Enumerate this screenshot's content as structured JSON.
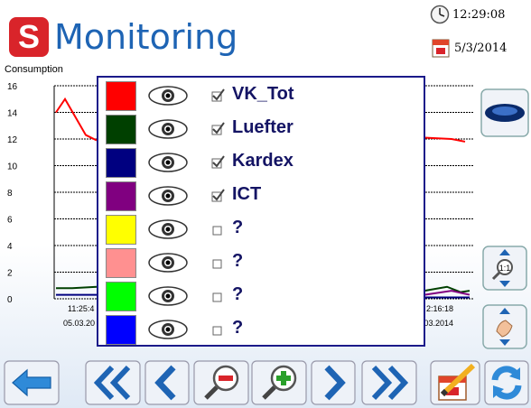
{
  "header": {
    "logo_letter": "S",
    "title": "Monitoring",
    "time": "12:29:08",
    "date": "5/3/2014"
  },
  "chart_data": {
    "type": "line",
    "ylabel": "Consumption",
    "ylim": [
      0,
      16
    ],
    "y_ticks": [
      "0",
      "2",
      "4",
      "6",
      "8",
      "10",
      "12",
      "14",
      "16"
    ],
    "x_tick_times": [
      "11:25:4",
      "2:16:18"
    ],
    "x_tick_dates": [
      "05.03.20",
      ".03.2014"
    ],
    "grid": true
  },
  "legend": {
    "series": [
      {
        "name": "VK_Tot",
        "color": "#ff0000",
        "checked": true
      },
      {
        "name": "Luefter",
        "color": "#004000",
        "checked": true
      },
      {
        "name": "Kardex",
        "color": "#000080",
        "checked": true
      },
      {
        "name": "ICT",
        "color": "#800080",
        "checked": true
      },
      {
        "name": "?",
        "color": "#ffff00",
        "checked": false
      },
      {
        "name": "?",
        "color": "#ff9090",
        "checked": false
      },
      {
        "name": "?",
        "color": "#00ff00",
        "checked": false
      },
      {
        "name": "?",
        "color": "#0000ff",
        "checked": false
      }
    ]
  },
  "icons": {
    "side": [
      "eye-icon",
      "zoom-fit-icon",
      "pan-hand-icon"
    ],
    "toolbar": [
      "back-arrow-icon",
      "fast-rewind-icon",
      "previous-icon",
      "zoom-out-icon",
      "zoom-in-icon",
      "next-icon",
      "fast-forward-icon",
      "edit-calendar-icon",
      "refresh-icon"
    ]
  }
}
